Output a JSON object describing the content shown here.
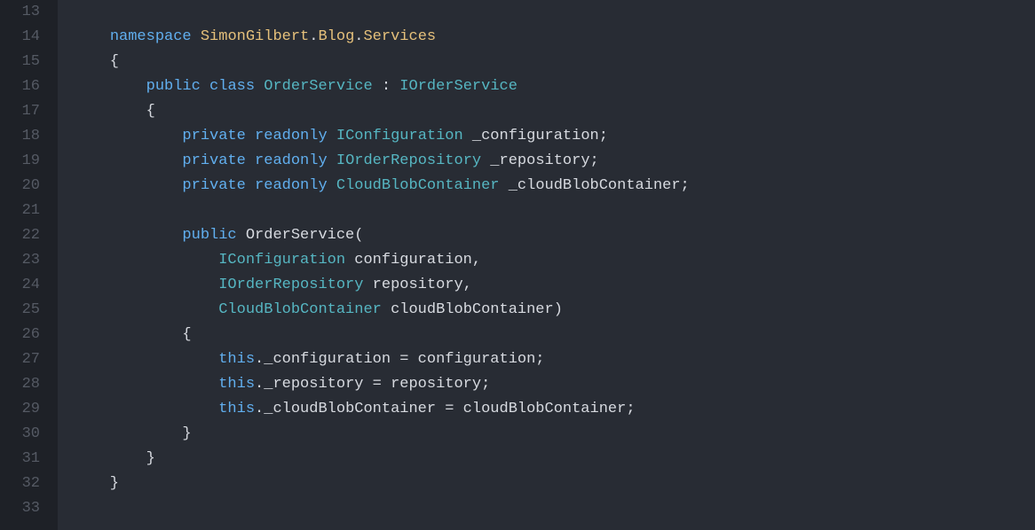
{
  "lines": [
    {
      "num": "13",
      "tokens": []
    },
    {
      "num": "14",
      "tokens": [
        {
          "t": "    ",
          "c": "plain"
        },
        {
          "t": "namespace",
          "c": "kw"
        },
        {
          "t": " ",
          "c": "plain"
        },
        {
          "t": "SimonGilbert",
          "c": "cls"
        },
        {
          "t": ".",
          "c": "plain"
        },
        {
          "t": "Blog",
          "c": "cls"
        },
        {
          "t": ".",
          "c": "plain"
        },
        {
          "t": "Services",
          "c": "cls"
        }
      ]
    },
    {
      "num": "15",
      "tokens": [
        {
          "t": "    {",
          "c": "plain"
        }
      ]
    },
    {
      "num": "16",
      "tokens": [
        {
          "t": "        ",
          "c": "plain"
        },
        {
          "t": "public",
          "c": "kw"
        },
        {
          "t": " ",
          "c": "plain"
        },
        {
          "t": "class",
          "c": "kw"
        },
        {
          "t": " ",
          "c": "plain"
        },
        {
          "t": "OrderService",
          "c": "type"
        },
        {
          "t": " : ",
          "c": "plain"
        },
        {
          "t": "IOrderService",
          "c": "type"
        }
      ]
    },
    {
      "num": "17",
      "tokens": [
        {
          "t": "        {",
          "c": "plain"
        }
      ]
    },
    {
      "num": "18",
      "tokens": [
        {
          "t": "            ",
          "c": "plain"
        },
        {
          "t": "private",
          "c": "kw"
        },
        {
          "t": " ",
          "c": "plain"
        },
        {
          "t": "readonly",
          "c": "kw"
        },
        {
          "t": " ",
          "c": "plain"
        },
        {
          "t": "IConfiguration",
          "c": "type"
        },
        {
          "t": " _configuration;",
          "c": "plain"
        }
      ]
    },
    {
      "num": "19",
      "tokens": [
        {
          "t": "            ",
          "c": "plain"
        },
        {
          "t": "private",
          "c": "kw"
        },
        {
          "t": " ",
          "c": "plain"
        },
        {
          "t": "readonly",
          "c": "kw"
        },
        {
          "t": " ",
          "c": "plain"
        },
        {
          "t": "IOrderRepository",
          "c": "type"
        },
        {
          "t": " _repository;",
          "c": "plain"
        }
      ]
    },
    {
      "num": "20",
      "tokens": [
        {
          "t": "            ",
          "c": "plain"
        },
        {
          "t": "private",
          "c": "kw"
        },
        {
          "t": " ",
          "c": "plain"
        },
        {
          "t": "readonly",
          "c": "kw"
        },
        {
          "t": " ",
          "c": "plain"
        },
        {
          "t": "CloudBlobContainer",
          "c": "type"
        },
        {
          "t": " _cloudBlobContainer;",
          "c": "plain"
        }
      ]
    },
    {
      "num": "21",
      "tokens": []
    },
    {
      "num": "22",
      "tokens": [
        {
          "t": "            ",
          "c": "plain"
        },
        {
          "t": "public",
          "c": "kw"
        },
        {
          "t": " OrderService(",
          "c": "plain"
        }
      ]
    },
    {
      "num": "23",
      "tokens": [
        {
          "t": "                ",
          "c": "plain"
        },
        {
          "t": "IConfiguration",
          "c": "type"
        },
        {
          "t": " configuration,",
          "c": "plain"
        }
      ]
    },
    {
      "num": "24",
      "tokens": [
        {
          "t": "                ",
          "c": "plain"
        },
        {
          "t": "IOrderRepository",
          "c": "type"
        },
        {
          "t": " repository,",
          "c": "plain"
        }
      ]
    },
    {
      "num": "25",
      "tokens": [
        {
          "t": "                ",
          "c": "plain"
        },
        {
          "t": "CloudBlobContainer",
          "c": "type"
        },
        {
          "t": " cloudBlobContainer)",
          "c": "plain"
        }
      ]
    },
    {
      "num": "26",
      "tokens": [
        {
          "t": "            {",
          "c": "plain"
        }
      ]
    },
    {
      "num": "27",
      "tokens": [
        {
          "t": "                ",
          "c": "plain"
        },
        {
          "t": "this",
          "c": "kw"
        },
        {
          "t": "._configuration = configuration;",
          "c": "plain"
        }
      ]
    },
    {
      "num": "28",
      "tokens": [
        {
          "t": "                ",
          "c": "plain"
        },
        {
          "t": "this",
          "c": "kw"
        },
        {
          "t": "._repository = repository;",
          "c": "plain"
        }
      ]
    },
    {
      "num": "29",
      "tokens": [
        {
          "t": "                ",
          "c": "plain"
        },
        {
          "t": "this",
          "c": "kw"
        },
        {
          "t": "._cloudBlobContainer = cloudBlobContainer;",
          "c": "plain"
        }
      ]
    },
    {
      "num": "30",
      "tokens": [
        {
          "t": "            }",
          "c": "plain"
        }
      ]
    },
    {
      "num": "31",
      "tokens": [
        {
          "t": "        }",
          "c": "plain"
        }
      ]
    },
    {
      "num": "32",
      "tokens": [
        {
          "t": "    }",
          "c": "plain"
        }
      ]
    },
    {
      "num": "33",
      "tokens": []
    }
  ]
}
